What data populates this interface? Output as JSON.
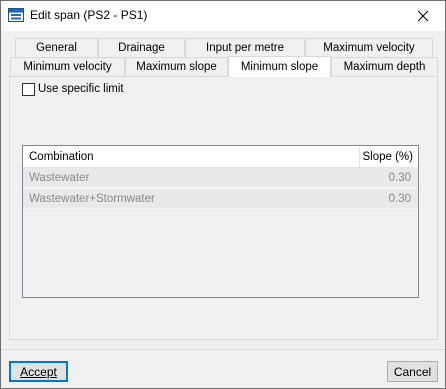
{
  "window": {
    "title": "Edit span (PS2 - PS1)"
  },
  "icons": {
    "app": "app-window-icon",
    "close": "close-icon"
  },
  "tabs": {
    "row1": [
      "General",
      "Drainage",
      "Input per metre",
      "Maximum velocity"
    ],
    "row2": [
      "Minimum velocity",
      "Maximum slope",
      "Minimum slope",
      "Maximum depth"
    ],
    "selected": "Minimum slope"
  },
  "panel": {
    "use_specific_limit_label": "Use specific limit",
    "use_specific_limit_checked": false,
    "grid": {
      "columns": [
        "Combination",
        "Slope (%)"
      ],
      "rows": [
        {
          "combination": "Wastewater",
          "slope": "0.30"
        },
        {
          "combination": "Wastewater+Stormwater",
          "slope": "0.30"
        }
      ]
    }
  },
  "footer": {
    "accept_label": "Accept",
    "cancel_label": "Cancel"
  }
}
